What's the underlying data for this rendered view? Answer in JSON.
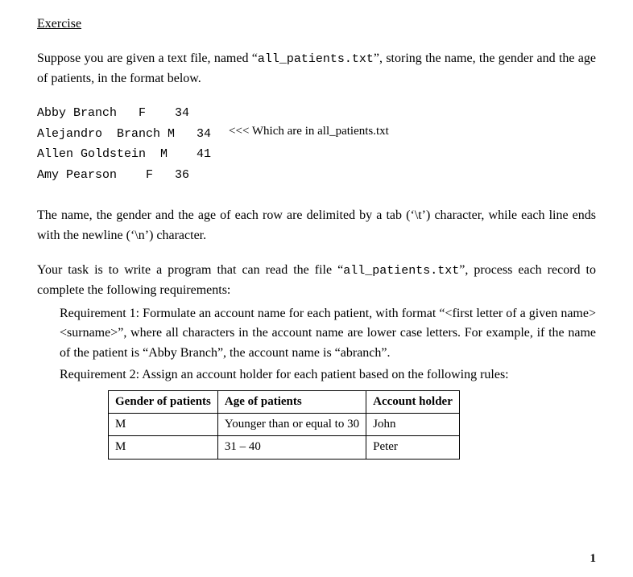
{
  "heading": "Exercise",
  "intro_part1": "Suppose you are given a text file, named “",
  "intro_filename": "all_patients.txt",
  "intro_part2": "”, storing the name, the gender and the age of patients, in the format below.",
  "file_lines": "Abby Branch   F    34\nAlejandro  Branch M   34\nAllen Goldstein  M    41\nAmy Pearson    F   36",
  "annotation": "<<<  Which are in all_patients.txt",
  "delimiter_para": "The name, the gender and the age of each row are delimited by a tab (‘\\t’) character, while each line ends with the newline (‘\\n’) character.",
  "task_part1": "Your task is to write a program that can read the file “",
  "task_filename": "all_patients.txt",
  "task_part2": "”, process each record to complete the following requirements:",
  "req1": "Requirement 1: Formulate an account name for each patient, with format “<first letter of a given name><surname>”, where all characters in the account name are lower case letters. For example, if the name of the patient is “Abby Branch”, the account name is “abranch”.",
  "req2_intro": "Requirement 2: Assign an account holder for each patient based on the following rules:",
  "table": {
    "headers": [
      "Gender of patients",
      "Age of patients",
      "Account holder"
    ],
    "rows": [
      [
        "M",
        "Younger than or equal to 30",
        "John"
      ],
      [
        "M",
        "31 – 40",
        "Peter"
      ]
    ]
  },
  "page_number": "1"
}
